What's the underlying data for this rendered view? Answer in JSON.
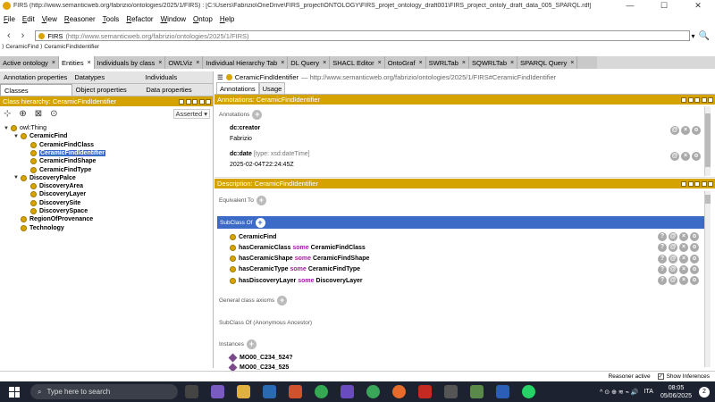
{
  "window": {
    "title": "FIRS (http://www.semanticweb.org/fabrizio/ontologies/2025/1/FIRS) : [C:\\Users\\Fabrizio\\OneDrive\\FIRS_project\\ONTOLOGY\\FIRS_projet_ontology_draft001\\FIRS_project_ontoly_draft_data_005_SPARQL.rdf]",
    "minimize": "—",
    "maximize": "☐",
    "close": "✕"
  },
  "menu": [
    "File",
    "Edit",
    "View",
    "Reasoner",
    "Tools",
    "Refactor",
    "Window",
    "Ontop",
    "Help"
  ],
  "nav": {
    "back": "‹",
    "forward": "›",
    "ontology_name": "FIRS",
    "ontology_iri": "(http://www.semanticweb.org/fabrizio/ontologies/2025/1/FIRS)",
    "dropdown": "▾",
    "search_icon": "🔍"
  },
  "breadcrumb": "⟩ CeramicFind ⟩ CeramicFindIdentifier",
  "tabs": [
    {
      "label": "Active ontology",
      "active": false
    },
    {
      "label": "Entities",
      "active": true
    },
    {
      "label": "Individuals by class",
      "active": false
    },
    {
      "label": "OWLViz",
      "active": false
    },
    {
      "label": "Individual Hierarchy Tab",
      "active": false
    },
    {
      "label": "DL Query",
      "active": false
    },
    {
      "label": "SHACL Editor",
      "active": false
    },
    {
      "label": "OntoGraf",
      "active": false
    },
    {
      "label": "SWRLTab",
      "active": false
    },
    {
      "label": "SQWRLTab",
      "active": false
    },
    {
      "label": "SPARQL Query",
      "active": false
    }
  ],
  "tab_close": "×",
  "left": {
    "subtabs_row1": [
      "Annotation properties",
      "Datatypes",
      "Individuals"
    ],
    "subtabs_row2": [
      "Classes",
      "Object properties",
      "Data properties"
    ],
    "hierarchy_title": "Class hierarchy: CeramicFindIdentifier",
    "asserted": "Asserted ▾",
    "tree": [
      {
        "label": "owl:Thing",
        "depth": 0,
        "toggle": "▼",
        "selected": false
      },
      {
        "label": "CeramicFind",
        "depth": 1,
        "toggle": "▼",
        "selected": false
      },
      {
        "label": "CeramicFindClass",
        "depth": 2,
        "toggle": "",
        "selected": false
      },
      {
        "label": "CeramicFindIdentifier",
        "depth": 2,
        "toggle": "",
        "selected": true
      },
      {
        "label": "CeramicFindShape",
        "depth": 2,
        "toggle": "",
        "selected": false
      },
      {
        "label": "CeramicFindType",
        "depth": 2,
        "toggle": "",
        "selected": false
      },
      {
        "label": "DiscoveryPalce",
        "depth": 1,
        "toggle": "▼",
        "selected": false
      },
      {
        "label": "DiscoveryArea",
        "depth": 2,
        "toggle": "",
        "selected": false
      },
      {
        "label": "DiscoveryLayer",
        "depth": 2,
        "toggle": "",
        "selected": false
      },
      {
        "label": "DiscoverySite",
        "depth": 2,
        "toggle": "",
        "selected": false
      },
      {
        "label": "DiscoverySpace",
        "depth": 2,
        "toggle": "",
        "selected": false
      },
      {
        "label": "RegionOfProvenance",
        "depth": 1,
        "toggle": "",
        "selected": false
      },
      {
        "label": "Technology",
        "depth": 1,
        "toggle": "",
        "selected": false
      }
    ]
  },
  "right": {
    "class_name": "CeramicFindIdentifier",
    "class_iri": "— http://www.semanticweb.org/fabrizio/ontologies/2025/1/FIRS#CeramicFindIdentifier",
    "annotabs": [
      "Annotations",
      "Usage"
    ],
    "annotations_title": "Annotations: CeramicFindIdentifier",
    "annotations_label": "Annotations",
    "annotations": [
      {
        "prop": "dc:creator",
        "type": "",
        "value": "Fabrizio"
      },
      {
        "prop": "dc:date",
        "type": "[type: xsd:dateTime]",
        "value": "2025-02-04T22:24:45Z"
      }
    ],
    "description_title": "Description: CeramicFindIdentifier",
    "equivalent_to": "Equivalent To",
    "subclass_of": "SubClass Of",
    "subclass_rows": [
      {
        "pre": "CeramicFind",
        "kw": "",
        "post": ""
      },
      {
        "pre": "hasCeramicClass",
        "kw": "some",
        "post": "CeramicFindClass"
      },
      {
        "pre": "hasCeramicShape",
        "kw": "some",
        "post": "CeramicFindShape"
      },
      {
        "pre": "hasCeramicType",
        "kw": "some",
        "post": "CeramicFindType"
      },
      {
        "pre": "hasDiscoveryLayer",
        "kw": "some",
        "post": "DiscoveryLayer"
      }
    ],
    "general_axioms": "General class axioms",
    "anonymous_ancestor": "SubClass Of (Anonymous Ancestor)",
    "instances": "Instances",
    "instance_rows": [
      "MO00_C234_524?",
      "MO00_C234_525"
    ]
  },
  "status": {
    "reasoner": "Reasoner active",
    "check": "✓",
    "show_inferences": "Show Inferences"
  },
  "taskbar": {
    "search_placeholder": "Type here to search",
    "time": "08:05",
    "date": "05/06/2025",
    "lang": "ITA",
    "notif": "2",
    "tray_icons": "^ ⊙ ⊕ ≋ ⌁ 🔊"
  }
}
